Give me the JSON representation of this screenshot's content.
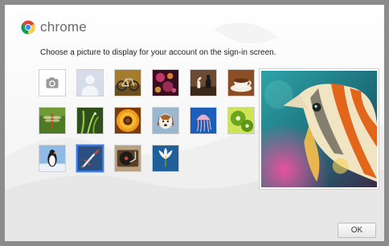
{
  "header": {
    "brand": "chrome"
  },
  "instructions": "Choose a picture to display for your account on the sign-in screen.",
  "pictures": [
    {
      "name": "camera",
      "selected": false
    },
    {
      "name": "default-avatar",
      "selected": false
    },
    {
      "name": "bicycle",
      "selected": false
    },
    {
      "name": "bokeh-lights",
      "selected": false
    },
    {
      "name": "chess-pieces",
      "selected": false
    },
    {
      "name": "coffee-cup",
      "selected": false
    },
    {
      "name": "dragonfly",
      "selected": false
    },
    {
      "name": "grass",
      "selected": false
    },
    {
      "name": "orange-flower",
      "selected": false
    },
    {
      "name": "dog",
      "selected": false
    },
    {
      "name": "jellyfish",
      "selected": false
    },
    {
      "name": "kiwi",
      "selected": false
    },
    {
      "name": "penguin",
      "selected": false
    },
    {
      "name": "rocket",
      "selected": true
    },
    {
      "name": "record-player",
      "selected": false
    },
    {
      "name": "white-flower",
      "selected": false
    }
  ],
  "preview": {
    "subject": "butterflyfish"
  },
  "buttons": {
    "ok_label": "OK"
  }
}
